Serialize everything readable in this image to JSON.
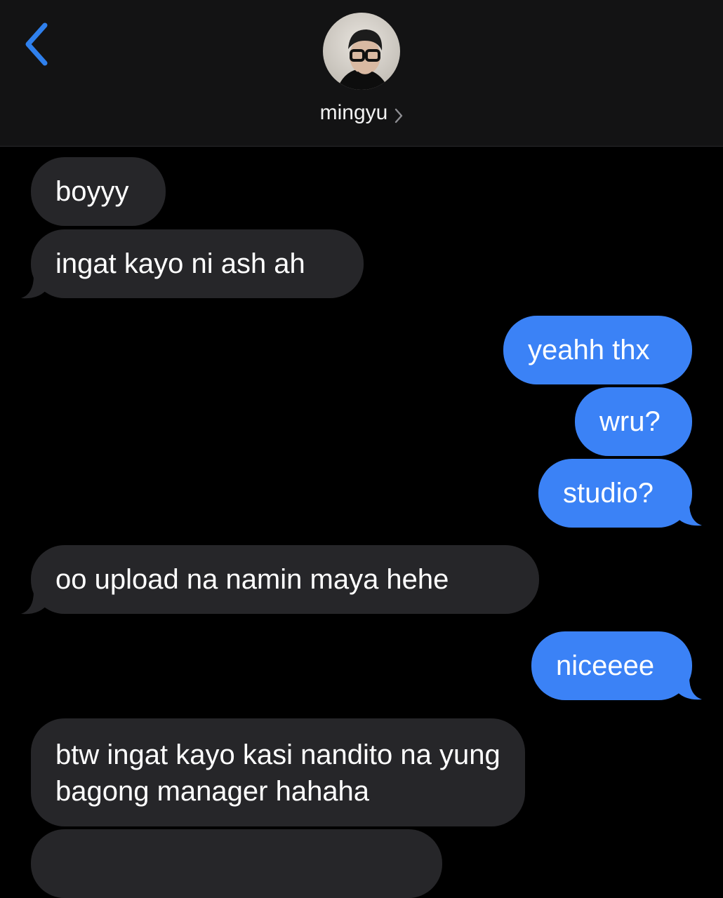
{
  "header": {
    "contact_name": "mingyu"
  },
  "icons": {
    "back": "chevron-left-icon",
    "contact_chevron": "chevron-right-icon"
  },
  "colors": {
    "background": "#000000",
    "header_bg": "#131314",
    "incoming_bubble": "#262629",
    "outgoing_bubble": "#3b82f6",
    "accent": "#2f80ed"
  },
  "messages": [
    {
      "sender": "them",
      "text": "boyyy"
    },
    {
      "sender": "them",
      "text": "ingat kayo ni ash ah"
    },
    {
      "sender": "me",
      "text": "yeahh thx"
    },
    {
      "sender": "me",
      "text": "wru?"
    },
    {
      "sender": "me",
      "text": "studio?"
    },
    {
      "sender": "them",
      "text": "oo upload na namin maya hehe"
    },
    {
      "sender": "me",
      "text": "niceeee"
    },
    {
      "sender": "them",
      "text": "btw ingat kayo kasi nandito na yung bagong manager hahaha"
    }
  ]
}
